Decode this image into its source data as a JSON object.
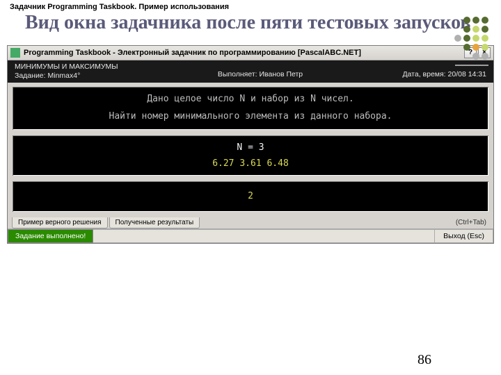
{
  "slide": {
    "header": "Задачник Programming Taskbook. Пример использования",
    "title": "Вид окна задачника после пяти тестовых запусков",
    "page_number": "86"
  },
  "window": {
    "title": "Programming Taskbook - Электронный задачник по программированию [PascalABC.NET]",
    "help_btn": "?",
    "close_btn": "×"
  },
  "info": {
    "heading": "МИНИМУМЫ И МАКСИМУМЫ",
    "task_label": "Задание: Minmax4°",
    "performer": "Выполняет: Иванов Петр",
    "datetime": "Дата, время: 20/08 14:31"
  },
  "console": {
    "box1_line1": "Дано целое число N и набор из N чисел.",
    "box1_line2": "Найти номер минимального элемента из данного набора.",
    "box2_line1": "N = 3",
    "box2_line2": "6.27   3.61   6.48",
    "box3_line1": "2"
  },
  "tabs": {
    "tab1": "Пример верного решения",
    "tab2": "Полученные результаты",
    "shortcut": "(Ctrl+Tab)"
  },
  "status": {
    "message": "Задание выполнено!",
    "exit": "Выход (Esc)"
  }
}
